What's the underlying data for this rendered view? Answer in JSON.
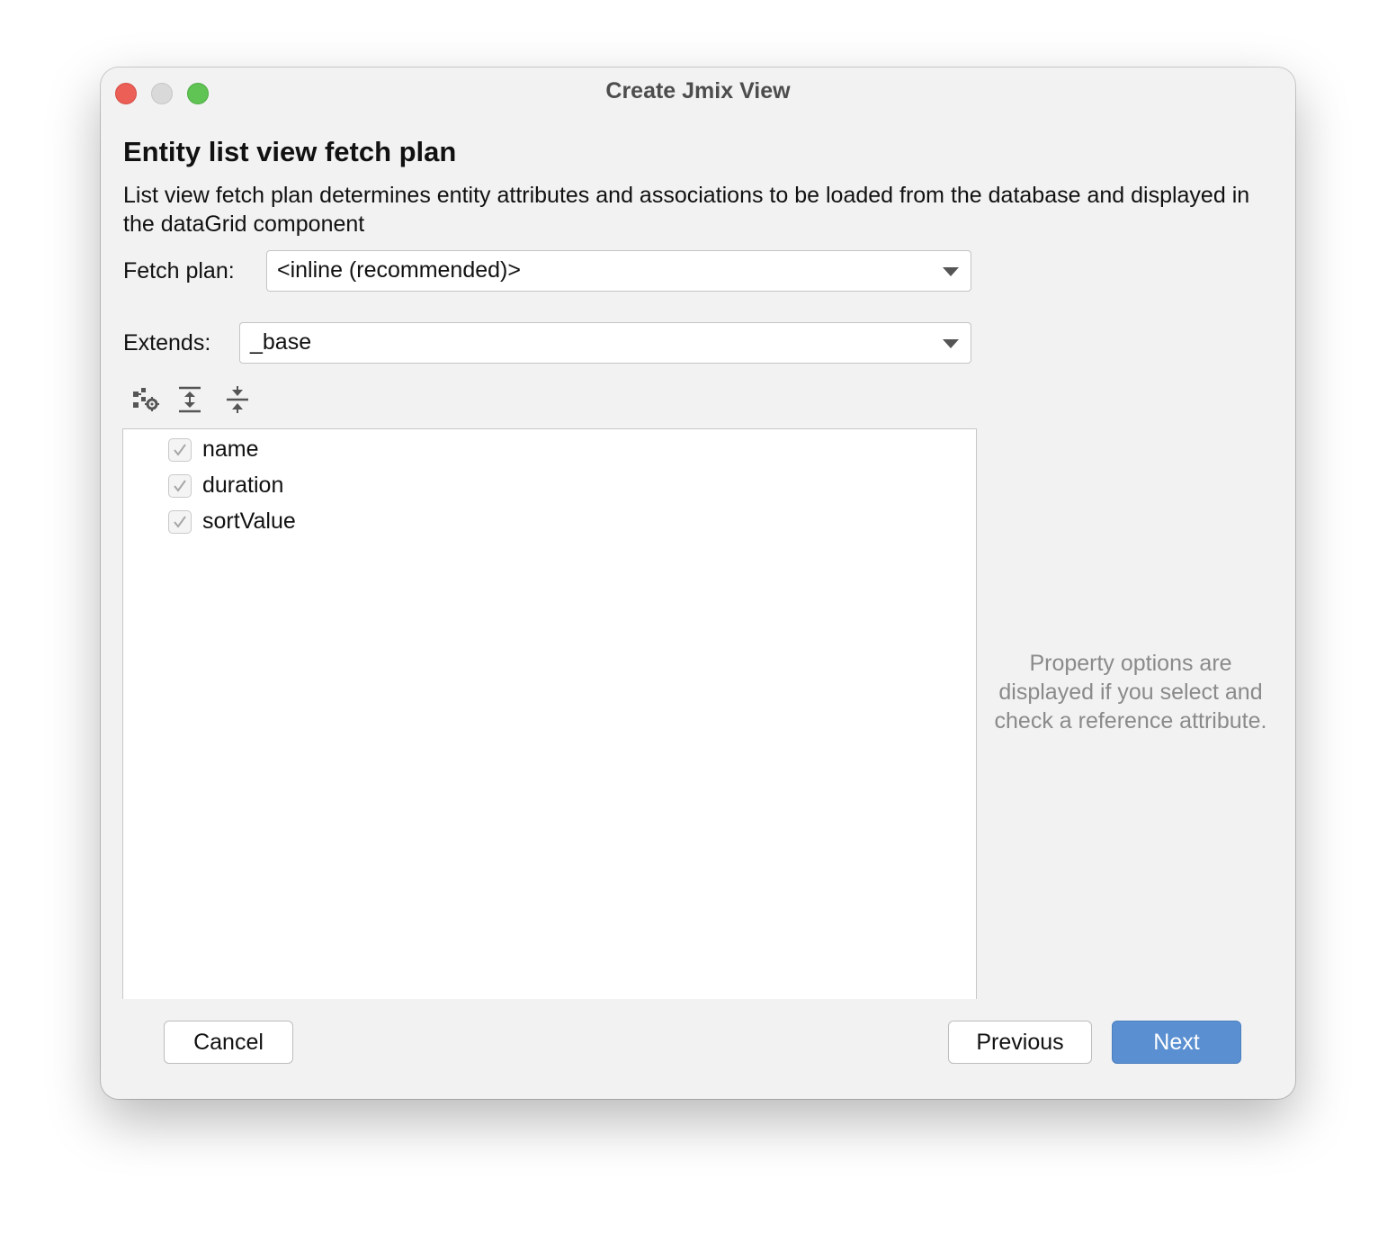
{
  "window": {
    "title": "Create Jmix View"
  },
  "page": {
    "heading": "Entity list view fetch plan",
    "description": "List view fetch plan determines entity attributes and associations to be loaded from the database and displayed in the dataGrid component"
  },
  "fetch_plan": {
    "label": "Fetch plan:",
    "value": "<inline (recommended)>"
  },
  "extends": {
    "label": "Extends:",
    "value": "_base"
  },
  "toolbar": {
    "icons": [
      "fetch-plan-settings-icon",
      "expand-all-icon",
      "collapse-all-icon"
    ]
  },
  "attributes": [
    {
      "name": "name",
      "checked": true
    },
    {
      "name": "duration",
      "checked": true
    },
    {
      "name": "sortValue",
      "checked": true
    }
  ],
  "hint": "Property options are displayed if you select and check a reference attribute.",
  "buttons": {
    "cancel": "Cancel",
    "previous": "Previous",
    "next": "Next"
  },
  "colors": {
    "primary_button": "#5a8fd1",
    "window_background": "#f2f2f2",
    "close": "#ec5f57",
    "minimize": "#d9d9d9",
    "maximize": "#5fc453"
  }
}
